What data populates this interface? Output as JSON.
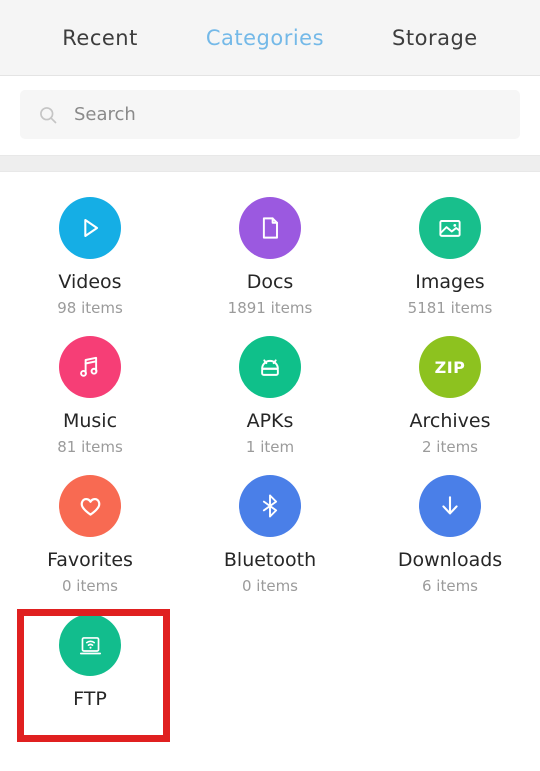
{
  "tabs": [
    {
      "label": "Recent",
      "active": false
    },
    {
      "label": "Categories",
      "active": true
    },
    {
      "label": "Storage",
      "active": false
    }
  ],
  "search": {
    "placeholder": "Search",
    "value": ""
  },
  "colors": {
    "active_tab": "#74b9e8",
    "tab_text": "#3d3d3d",
    "highlight": "#e02020",
    "count_text": "#9b9b9b",
    "label_text": "#262626",
    "search_background": "#f6f6f6",
    "tabbar_background": "#f5f5f5",
    "divider_band": "#eeeeee"
  },
  "categories": [
    {
      "name": "Videos",
      "count": "98 items",
      "icon": "play-icon",
      "color": "#15aee5"
    },
    {
      "name": "Docs",
      "count": "1891 items",
      "icon": "document-icon",
      "color": "#9b59e0"
    },
    {
      "name": "Images",
      "count": "5181 items",
      "icon": "photo-icon",
      "color": "#18bf8c"
    },
    {
      "name": "Music",
      "count": "81 items",
      "icon": "music-note-icon",
      "color": "#f63e76"
    },
    {
      "name": "APKs",
      "count": "1 item",
      "icon": "android-icon",
      "color": "#0fc08a"
    },
    {
      "name": "Archives",
      "count": "2 items",
      "icon": "zip-icon",
      "color": "#8dc21f"
    },
    {
      "name": "Favorites",
      "count": "0 items",
      "icon": "heart-icon",
      "color": "#f86a52"
    },
    {
      "name": "Bluetooth",
      "count": "0 items",
      "icon": "bluetooth-icon",
      "color": "#4a7fe8"
    },
    {
      "name": "Downloads",
      "count": "6 items",
      "icon": "download-icon",
      "color": "#4a7fe8"
    },
    {
      "name": "FTP",
      "count": "",
      "icon": "ftp-wifi-icon",
      "color": "#12bd8d"
    }
  ],
  "annotation": {
    "target": "FTP",
    "shape": "rectangle",
    "color": "#e02020"
  }
}
